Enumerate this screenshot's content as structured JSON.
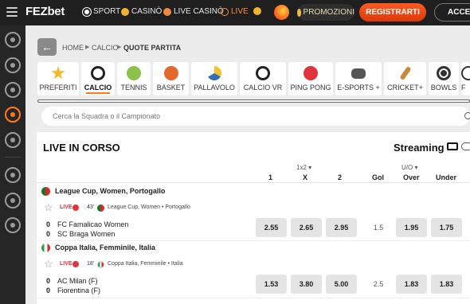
{
  "header": {
    "logo_main": "FEZ",
    "logo_accent": "bet",
    "nav": [
      {
        "label": "SPORT",
        "icon": "soccer-ball-icon"
      },
      {
        "label": "CASINÒ",
        "icon": "casino-chip-icon"
      },
      {
        "label": "LIVE CASINÒ",
        "icon": "live-casino-icon"
      },
      {
        "label": "LIVE",
        "icon": "live-play-icon"
      }
    ],
    "promo_label": "PROMOZIONI",
    "register_label": "REGISTRARTI",
    "login_label": "ACCEDI"
  },
  "sidebar": {
    "items": [
      "soccer-ball-icon",
      "clubs-icon",
      "basketball-icon",
      "live-stream-icon",
      "target-icon",
      "crosshair-icon",
      "poker-chip-icon",
      "trophy-icon"
    ],
    "active_index": 3
  },
  "breadcrumb": [
    "HOME",
    "CALCIO",
    "QUOTE PARTITA"
  ],
  "sports": [
    {
      "label": "PREFERITI",
      "icon": "star-icon",
      "color": "#f5b829"
    },
    {
      "label": "CALCIO",
      "icon": "soccer-ball-icon",
      "color": "#222222",
      "active": true
    },
    {
      "label": "TENNIS",
      "icon": "tennis-ball-icon",
      "color": "#8bc34a"
    },
    {
      "label": "BASKET",
      "icon": "basketball-icon",
      "color": "#e3682b"
    },
    {
      "label": "PALLAVOLO",
      "icon": "volleyball-icon",
      "color": "#2f6db5"
    },
    {
      "label": "CALCIO VR",
      "icon": "virtual-soccer-icon",
      "color": "#222222"
    },
    {
      "label": "PING PONG",
      "icon": "ping-pong-icon",
      "color": "#e0343a"
    },
    {
      "label": "E-SPORTS +",
      "icon": "gamepad-icon",
      "color": "#444444"
    },
    {
      "label": "CRICKET+",
      "icon": "cricket-icon",
      "color": "#c48a3a"
    },
    {
      "label": "BOWLS",
      "icon": "bowls-icon",
      "color": "#333333"
    },
    {
      "label": "F",
      "icon": "more-icon",
      "color": "#333333"
    }
  ],
  "search": {
    "placeholder": "Cerca la Squadra o il Campionato"
  },
  "live": {
    "title": "LIVE IN CORSO",
    "streaming_label": "Streaming",
    "market_1x2": "1x2",
    "market_uo": "U/O",
    "columns": [
      "1",
      "X",
      "2",
      "Gol",
      "Over",
      "Under"
    ],
    "events": [
      {
        "league": "League Cup, Women, Portogallo",
        "flag_color": "#0a7a2f",
        "live_label": "LIVE",
        "minute": "43'",
        "meta_league": "League Cup, Women",
        "meta_country": "Portogallo",
        "home_score": "0",
        "home_team": "FC Famalicao Women",
        "away_score": "0",
        "away_team": "SC Braga Women",
        "odds": [
          "2.55",
          "2.65",
          "2.95"
        ],
        "line": "1.5",
        "over_under": [
          "1.95",
          "1.75"
        ]
      },
      {
        "league": "Coppa Italia, Femminile, Italia",
        "flag_color": "#2a9d48",
        "live_label": "LIVE",
        "minute": "18'",
        "meta_league": "Coppa Italia, Femminile",
        "meta_country": "Italia",
        "home_score": "0",
        "home_team": "AC Milan (F)",
        "away_score": "0",
        "away_team": "Fiorentina (F)",
        "odds": [
          "1.53",
          "3.80",
          "5.00"
        ],
        "line": "2.5",
        "over_under": [
          "1.83",
          "1.83"
        ]
      }
    ]
  }
}
